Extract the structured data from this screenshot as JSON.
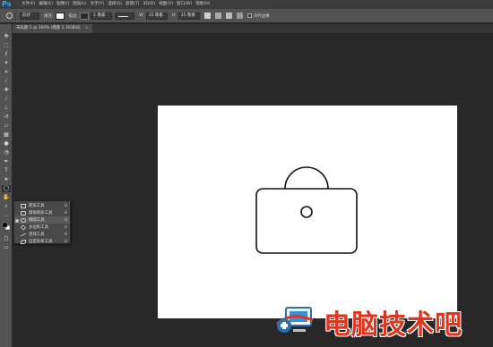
{
  "app": {
    "logo": "Ps"
  },
  "menu": [
    "文件(F)",
    "编辑(E)",
    "图像(I)",
    "图层(L)",
    "文字(Y)",
    "选择(S)",
    "滤镜(T)",
    "3D(D)",
    "视图(V)",
    "窗口(W)",
    "帮助(H)"
  ],
  "options": {
    "mode": "形状",
    "fill_label": "填充:",
    "stroke_label": "描边:",
    "stroke_width": "1 像素",
    "w_label": "W:",
    "w_value": "35 像素",
    "h_label": "H:",
    "h_value": "35 像素",
    "align_edges": "对齐边缘"
  },
  "document_tab": {
    "title": "未标题-1 @ 100% (椭圆 1, RGB/8)",
    "close": "×"
  },
  "tools": [
    "move-icon",
    "marquee-icon",
    "lasso-icon",
    "magic-wand-icon",
    "crop-icon",
    "eyedropper-icon",
    "healing-icon",
    "brush-icon",
    "stamp-icon",
    "history-brush-icon",
    "eraser-icon",
    "gradient-icon",
    "blur-icon",
    "dodge-icon",
    "pen-icon",
    "type-icon",
    "path-select-icon",
    "shape-icon",
    "hand-icon",
    "zoom-icon",
    "more-icon"
  ],
  "shape_flyout": {
    "items": [
      {
        "label": "矩形工具",
        "key": "U",
        "icon": "rectangle-icon"
      },
      {
        "label": "圆角矩形工具",
        "key": "U",
        "icon": "rounded-rectangle-icon"
      },
      {
        "label": "椭圆工具",
        "key": "U",
        "icon": "ellipse-icon",
        "selected": true
      },
      {
        "label": "多边形工具",
        "key": "U",
        "icon": "polygon-icon"
      },
      {
        "label": "直线工具",
        "key": "U",
        "icon": "line-icon"
      },
      {
        "label": "自定形状工具",
        "key": "U",
        "icon": "custom-shape-icon"
      }
    ]
  },
  "watermark": {
    "text": "电脑技术吧"
  },
  "colors": {
    "menubar": "#3c3c3c",
    "options_bar": "#535353",
    "workspace": "#282828",
    "canvas": "#ffffff",
    "watermark": "#e0351f",
    "ps_blue": "#31a8ff"
  }
}
